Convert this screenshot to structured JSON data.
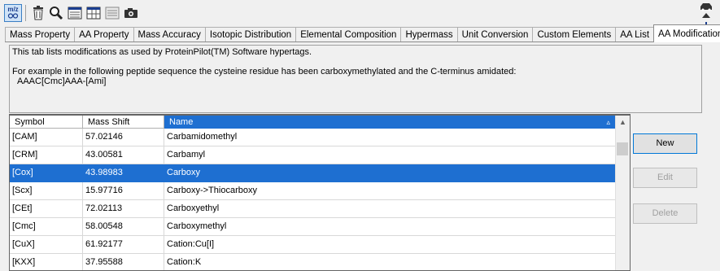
{
  "toolbar": {
    "mz_label": "m/z",
    "buttons": [
      "mz-icon",
      "trash-icon",
      "search-icon",
      "calculator-icon",
      "table-icon",
      "list-icon",
      "camera-icon"
    ]
  },
  "tabs": [
    {
      "label": "Mass Property"
    },
    {
      "label": "AA Property"
    },
    {
      "label": "Mass Accuracy"
    },
    {
      "label": "Isotopic Distribution"
    },
    {
      "label": "Elemental Composition"
    },
    {
      "label": "Hypermass"
    },
    {
      "label": "Unit Conversion"
    },
    {
      "label": "Custom Elements"
    },
    {
      "label": "AA List"
    },
    {
      "label": "AA Modifications",
      "active": true
    }
  ],
  "description": {
    "line1": "This tab lists modifications as used by ProteinPilot(TM) Software hypertags.",
    "line2": "For example in the following peptide sequence the cysteine residue has been carboxymethylated and the C-terminus amidated:",
    "line3": "AAAC[Cmc]AAA-[Ami]"
  },
  "table": {
    "columns": [
      "Symbol",
      "Mass Shift",
      "Name"
    ],
    "sort_indicator": "▵",
    "rows": [
      [
        "[CAM]",
        "57.02146",
        "Carbamidomethyl"
      ],
      [
        "[CRM]",
        "43.00581",
        "Carbamyl"
      ],
      [
        "[Cox]",
        "43.98983",
        "Carboxy"
      ],
      [
        "[Scx]",
        "15.97716",
        "Carboxy->Thiocarboxy"
      ],
      [
        "[CEt]",
        "72.02113",
        "Carboxyethyl"
      ],
      [
        "[Cmc]",
        "58.00548",
        "Carboxymethyl"
      ],
      [
        "[CuX]",
        "61.92177",
        "Cation:Cu[I]"
      ],
      [
        "[KXX]",
        "37.95588",
        "Cation:K"
      ]
    ],
    "selected_row": 2
  },
  "actions": {
    "new_label": "New",
    "edit_label": "Edit",
    "delete_label": "Delete"
  }
}
